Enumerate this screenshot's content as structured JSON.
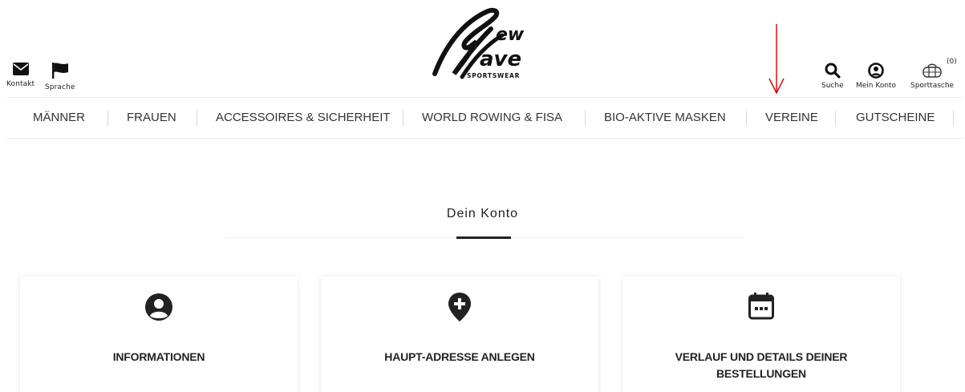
{
  "header": {
    "kontakt_label": "Kontakt",
    "sprache_label": "Sprache",
    "suche_label": "Suche",
    "konto_label": "Mein Konto",
    "tasche_label": "Sporttasche",
    "cart_count": "(0)",
    "logo_text": [
      "ew",
      "ave",
      "SPORTSWEAR"
    ]
  },
  "nav": {
    "items": [
      "MÄNNER",
      "FRAUEN",
      "ACCESSOIRES & SICHERHEIT",
      "WORLD ROWING & FISA",
      "BIO-AKTIVE MASKEN",
      "VEREINE",
      "GUTSCHEINE"
    ]
  },
  "main": {
    "title": "Dein Konto",
    "cards": [
      {
        "label": "INFORMATIONEN",
        "icon": "user-circle-icon"
      },
      {
        "label": "HAUPT-ADRESSE ANLEGEN",
        "icon": "add-location-icon"
      },
      {
        "label": "VERLAUF UND DETAILS DEINER BESTELLUNGEN",
        "icon": "calendar-icon"
      }
    ]
  },
  "colors": {
    "annotation_arrow": "#d40000",
    "text": "#222222"
  }
}
